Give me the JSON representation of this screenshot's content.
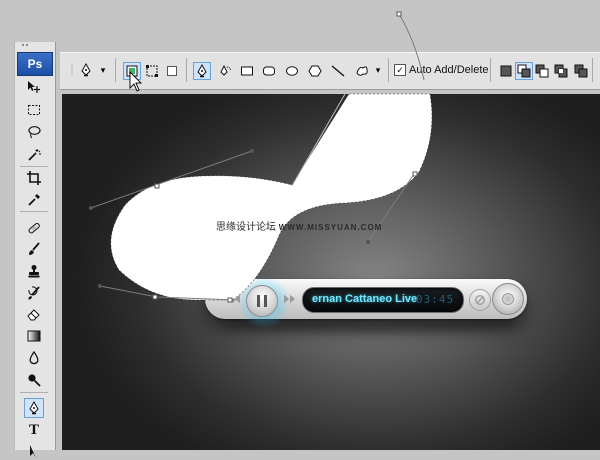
{
  "app": {
    "logo_text": "Ps",
    "accent_color": "#2f60b8"
  },
  "toolbox": {
    "tools": [
      {
        "name": "move-tool",
        "icon": "move-icon"
      },
      {
        "name": "marquee-tool",
        "icon": "marquee-icon"
      },
      {
        "name": "lasso-tool",
        "icon": "lasso-icon"
      },
      {
        "name": "magic-wand-tool",
        "icon": "magic-wand-icon"
      },
      {
        "name": "crop-tool",
        "icon": "crop-icon"
      },
      {
        "name": "eyedropper-tool",
        "icon": "eyedropper-icon"
      },
      {
        "name": "healing-brush-tool",
        "icon": "bandage-icon"
      },
      {
        "name": "brush-tool",
        "icon": "brush-icon"
      },
      {
        "name": "clone-stamp-tool",
        "icon": "stamp-icon"
      },
      {
        "name": "history-brush-tool",
        "icon": "history-brush-icon"
      },
      {
        "name": "eraser-tool",
        "icon": "eraser-icon"
      },
      {
        "name": "gradient-tool",
        "icon": "gradient-icon"
      },
      {
        "name": "blur-tool",
        "icon": "drop-icon"
      },
      {
        "name": "dodge-tool",
        "icon": "dodge-icon"
      },
      {
        "name": "pen-tool",
        "icon": "pen-icon",
        "active": true
      },
      {
        "name": "type-tool",
        "icon": "type-icon",
        "label": "T"
      },
      {
        "name": "path-selection-tool",
        "icon": "arrow-icon"
      }
    ]
  },
  "options_bar": {
    "auto_add_delete": {
      "label": "Auto Add/Delete",
      "checked": true,
      "check_glyph": "✓"
    },
    "dropdown_glyph": "▾"
  },
  "canvas": {
    "background_color": "#3a3a3a",
    "watermark": {
      "text": "思缘设计论坛",
      "url": "WWW.MISSYUAN.COM"
    }
  },
  "media_player": {
    "track_title": "ernan Cattaneo Live",
    "time": "03:45",
    "display_color": "#6fe8ff",
    "glow_color": "#28dcff"
  }
}
